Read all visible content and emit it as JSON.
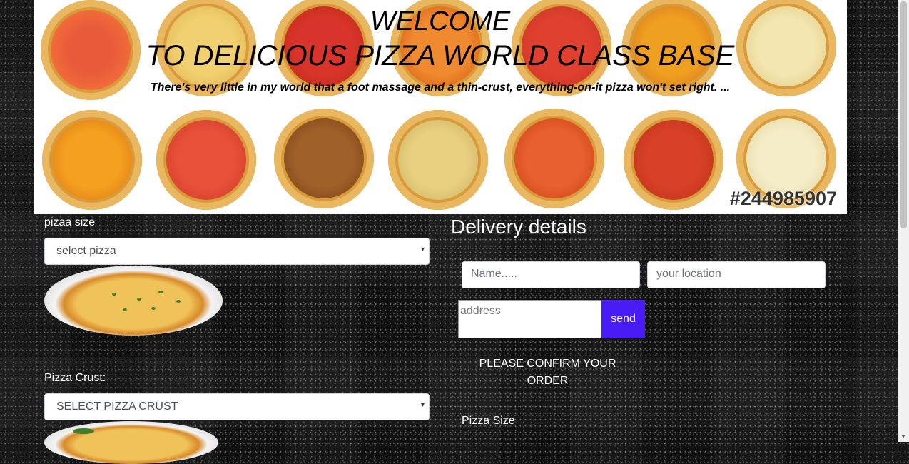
{
  "banner": {
    "welcome": "WELCOME",
    "title": "TO DELICIOUS PIZZA WORLD CLASS BASE",
    "quote": "There's very little in my world that a foot massage and a thin-crust, everything-on-it pizza won't set right. ...",
    "image_id": "#244985907"
  },
  "pizza_size": {
    "label": "pizaa size",
    "selected": "select pizza"
  },
  "pizza_crust": {
    "label": "Pizza Crust:",
    "selected": "SELECT PIZZA CRUST"
  },
  "delivery": {
    "heading": "Delivery details",
    "name_placeholder": "Name.....",
    "location_placeholder": "your location",
    "address_placeholder": "address",
    "send_label": "send",
    "confirm_text": "PLEASE CONFIRM YOUR ORDER",
    "summary_label": "Pizza Size"
  },
  "colors": {
    "send_button": "#4a1cf5",
    "banner_background": "#ffffff"
  }
}
